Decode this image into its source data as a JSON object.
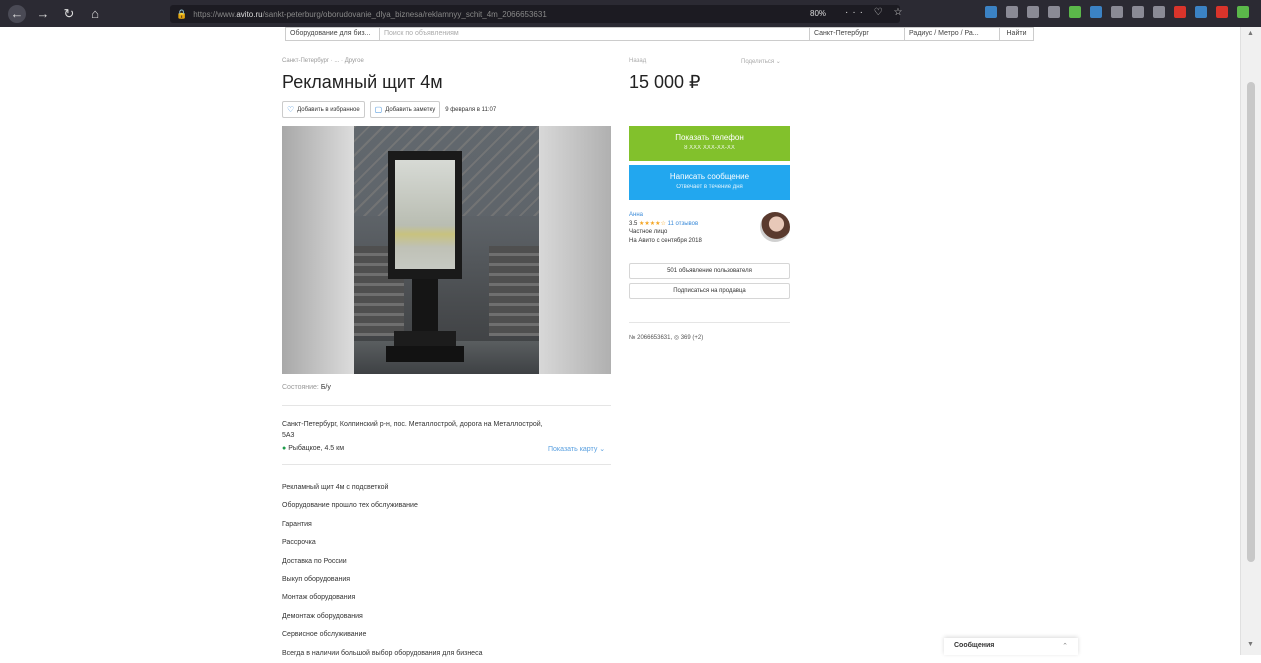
{
  "browser": {
    "url_prefix": "https://www.",
    "url_host": "avito.ru",
    "url_path": "/sankt-peterburg/oborudovanie_dlya_biznesa/reklamnyy_schit_4m_2066653631",
    "zoom": "80%",
    "actions": "··· ♡ ☆"
  },
  "search": {
    "category": "Оборудование для биз...",
    "placeholder": "Поиск по объявлениям",
    "city": "Санкт-Петербург",
    "radius": "Радиус / Метро / Ра...",
    "find": "Найти"
  },
  "breadcrumb": "Санкт-Петербург · ... · Другое",
  "title": "Рекламный щит 4м",
  "actions": {
    "favorite": "Добавить в избранное",
    "note": "Добавить заметку",
    "date": "9 февраля в 11:07"
  },
  "condition": {
    "label": "Состояние:",
    "value": "Б/у"
  },
  "address": "Санкт-Петербург, Колпинский р-н, пос. Металлострой, дорога на Металлострой, 5А3",
  "metro": "Рыбацкое, 4.5 км",
  "map_link": "Показать карту ⌄",
  "description": [
    "Рекламный щит 4м с подсветкой",
    "Оборудование прошло тех обслуживание",
    "Гарантия",
    "Рассрочка",
    "Доставка по России",
    "Выкуп оборудования",
    "Монтаж оборудования",
    "Демонтаж оборудования",
    "Сервисное обслуживание",
    "Всегда в наличии большой выбор оборудования для бизнеса"
  ],
  "sidebar": {
    "category": "Назад",
    "share": "Поделиться ⌄",
    "price": "15 000 ₽",
    "phone_label": "Показать телефон",
    "phone_sub": "8 XXX XXX-XX-XX",
    "message_label": "Написать сообщение",
    "message_sub": "Отвечает в течение дня",
    "seller_name": "Анна",
    "rating": "3.5",
    "stars": "★★★★☆",
    "reviews": "11 отзывов",
    "seller_type": "Частное лицо",
    "since": "На Авито с сентября 2018",
    "ads_button": "501 объявление пользователя",
    "subscribe_button": "Подписаться на продавца",
    "ad_number": "№ 2066653631,",
    "views": "◎ 369 (+2)"
  },
  "messages_widget": {
    "label": "Сообщения",
    "toggle": "⌃"
  },
  "colors": {
    "phone_button": "#82c12c",
    "message_button": "#22a7ef",
    "link": "#3b8bd9",
    "browser_chrome": "#2b2a33"
  }
}
